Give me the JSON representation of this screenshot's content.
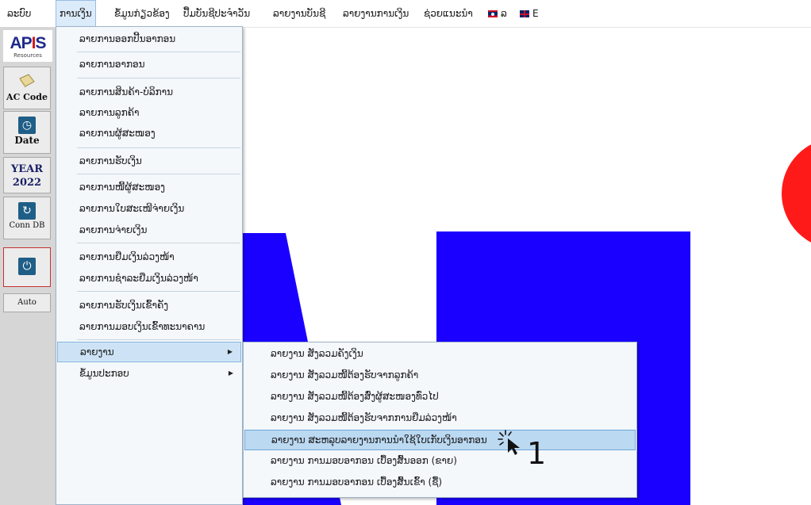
{
  "menubar": {
    "items": [
      {
        "label": "ລະບົບ"
      },
      {
        "label": "ການເງິນ"
      },
      {
        "label": "ຂໍ້ມູນກ່ຽວຂ້ອງ"
      },
      {
        "label": "ປື້ມບັນຊີປະຈຳວັນ"
      },
      {
        "label": "ລາຍງານບັນຊີ"
      },
      {
        "label": "ລາຍງານການເງິນ"
      },
      {
        "label": "ຊ່ວຍແນະນຳ"
      },
      {
        "label": "ລ"
      },
      {
        "label": "E"
      }
    ]
  },
  "toolbar": {
    "logo": {
      "text_main": "APIS",
      "text_sub": "Resources"
    },
    "ac_code": "AC Code",
    "date": "Date",
    "year_label": "YEAR",
    "year_value": "2022",
    "conn_db": "Conn DB",
    "auto": "Auto"
  },
  "dropdown": {
    "items": [
      {
        "label": "ລາຍການອອກປີ້ນອາກອນ"
      },
      {
        "label": "ລາຍການອາກອນ"
      },
      {
        "label": "ລາຍການສິນຄ້າ-ບໍລິການ"
      },
      {
        "label": "ລາຍການລູກຄ້າ"
      },
      {
        "label": "ລາຍການຜູ້ສະໜອງ"
      },
      {
        "label": "ລາຍການຮັບເງິນ"
      },
      {
        "label": "ລາຍການໜີ້ຜູ້ສະໜອງ"
      },
      {
        "label": "ລາຍການໃບສະເໜີຈ່າຍເງິນ"
      },
      {
        "label": "ລາຍການຈ່າຍເງິນ"
      },
      {
        "label": "ລາຍການຢືມເງິນລ່ວງໜ້າ"
      },
      {
        "label": "ລາຍການຊຳລະຢືມເງິນລ່ວງໜ້າ"
      },
      {
        "label": "ລາຍການຮັບເງິນເຂົ້າຄັງ"
      },
      {
        "label": "ລາຍການມອບເງິນເຂົ້າທະນາຄານ"
      },
      {
        "label": "ລາຍງານ"
      },
      {
        "label": "ຂໍ້ມູນປະກອບ"
      }
    ]
  },
  "submenu": {
    "items": [
      {
        "label": "ລາຍງານ ສັງລວມຄັງເງິນ"
      },
      {
        "label": "ລາຍງານ ສັງລວມໜີ້ຕ້ອງຮັບຈາກລູກຄ້າ"
      },
      {
        "label": "ລາຍງານ ສັງລວມໜີ້ຕ້ອງສົ່ງຜູ້ສະໜອງທົ່ວໄປ"
      },
      {
        "label": "ລາຍງານ ສັງລວມໜີ້ຕ້ອງຮັບຈາກການຢືມລ່ວງໜ້າ"
      },
      {
        "label": "ລາຍງານ ສະຫລຸບລາຍງານການນຳໃຊ້ໃບເກັບເງິນອາກອນ"
      },
      {
        "label": "ລາຍງານ ການມອບອາກອນ ເບື້ອງສົ້ນອອກ (ຂາຍ)"
      },
      {
        "label": "ລາຍງານ ການມອບອາກອນ ເບື້ອງສົ້ນເຂົ້າ (ຊື້)"
      }
    ]
  },
  "annotation": {
    "step": "1"
  },
  "colors": {
    "accent": "#1a00ff",
    "highlight": "#bcd9f2",
    "watermark_red": "#ff1a1a"
  },
  "icons": [
    "calendar-clock-icon",
    "refresh-icon",
    "power-icon",
    "book-icon",
    "mouse-cursor-icon"
  ]
}
